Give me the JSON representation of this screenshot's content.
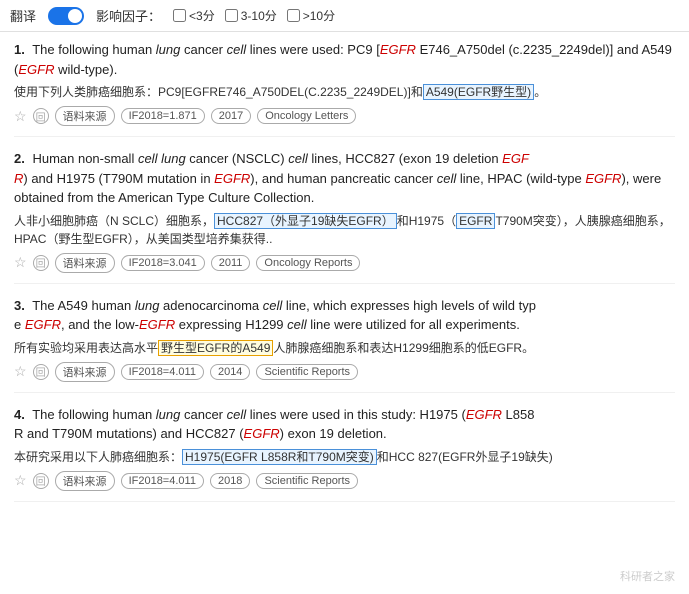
{
  "topbar": {
    "translate_label": "翻译",
    "impact_label": "影响因子：",
    "filter1": "<3分",
    "filter2": "3-10分",
    "filter3": ">10分"
  },
  "results": [
    {
      "num": "1.",
      "en": "The following human lung cancer cell lines were used: PC9 [EGFR E746_A750del (c.2235_2249del)] and A549 (EGFR wild-type).",
      "zh": "使用下列人类肺癌细胞系：PC9[EGFRE746_A750DEL(C.2235_2249DEL)]和A549(EGFR野生型)。",
      "star": "☆",
      "circle": "回",
      "tags": [
        "语料来源",
        "IF2018=1.871",
        "2017",
        "Oncology Letters"
      ]
    },
    {
      "num": "2.",
      "en": "Human non-small cell lung cancer (NSCLC) cell lines, HCC827 (exon 19 deletion EGFR) and H1975 (T790M mutation in EGFR), and human pancreatic cancer cell line, HPAC (wild-type EGFR), were obtained from the American Type Culture Collection.",
      "zh": "人非小细胞肺癌（N SCLC）细胞系，HCC827（外显子19缺失EGFR）和H1975（EGFR T790M突变），人胰腺癌细胞系，HPAC（野生型EGFR），从美国类型培养集获得..",
      "star": "☆",
      "circle": "回",
      "tags": [
        "语料来源",
        "IF2018=3.041",
        "2011",
        "Oncology Reports"
      ]
    },
    {
      "num": "3.",
      "en": "The A549 human lung adenocarcinoma cell line, which expresses high levels of wild type EGFR, and the low-EGFR expressing H1299 cell line were utilized for all experiments.",
      "zh": "所有实验均采用表达高水平野生型EGFR的A549人肺腺癌细胞系和表达H1299细胞系的低EGFR。",
      "star": "☆",
      "circle": "回",
      "tags": [
        "语料来源",
        "IF2018=4.011",
        "2014",
        "Scientific Reports"
      ]
    },
    {
      "num": "4.",
      "en": "The following human lung cancer cell lines were used in this study: H1975 (EGFR L858R and T790M mutations) and HCC827 (EGFR exon 19 deletion.",
      "zh": "本研究采用以下人肺癌细胞系：H1975(EGFR L858R和T790M突变)和HCC 827(EGFR外显子19缺失)",
      "star": "☆",
      "circle": "回",
      "tags": [
        "语料来源",
        "IF2018=4.011",
        "2018",
        "Scientific Reports"
      ]
    }
  ],
  "watermark": "科研者之家"
}
